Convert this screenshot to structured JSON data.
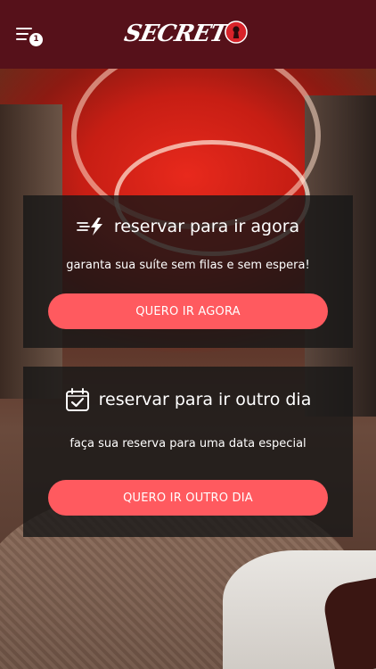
{
  "header": {
    "menu_icon": "menu-icon",
    "notification_count": "1",
    "logo_text": "SECRET",
    "logo_icon": "keyhole-icon",
    "colors": {
      "background": "#56111a",
      "logo_accent": "#d8232a"
    }
  },
  "cards": {
    "now": {
      "icon": "fast-bolt-icon",
      "title": "reservar para ir agora",
      "subtitle": "garanta sua suíte sem filas e sem espera!",
      "button_label": "QUERO IR AGORA"
    },
    "other_day": {
      "icon": "calendar-check-icon",
      "title": "reservar para ir outro dia",
      "subtitle": "faça sua reserva para uma data especial",
      "button_label": "QUERO IR OUTRO DIA"
    }
  },
  "colors": {
    "button": "#ff5a5f",
    "card_overlay": "#161616"
  }
}
